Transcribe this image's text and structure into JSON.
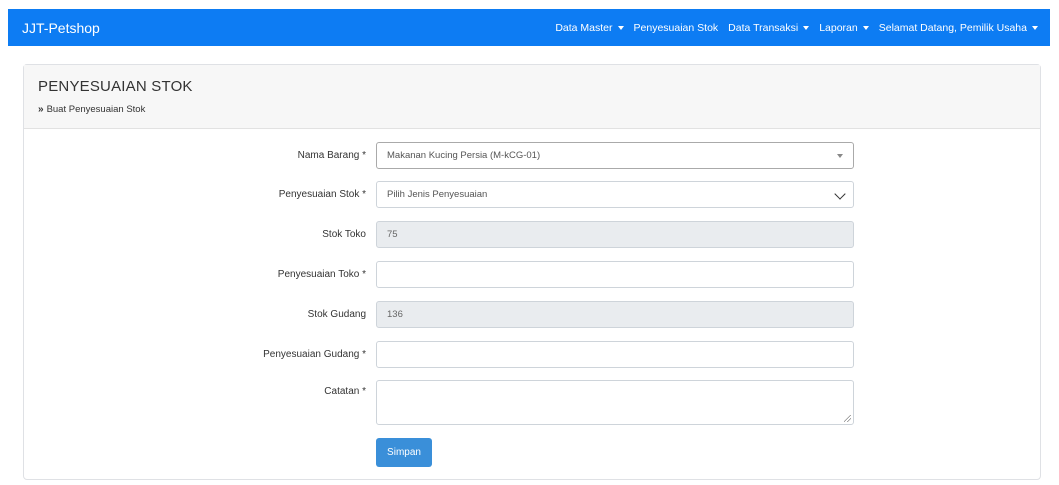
{
  "navbar": {
    "brand": "JJT-Petshop",
    "items": [
      {
        "label": "Data Master",
        "dropdown": true
      },
      {
        "label": "Penyesuaian Stok",
        "dropdown": false
      },
      {
        "label": "Data Transaksi",
        "dropdown": true
      },
      {
        "label": "Laporan",
        "dropdown": true
      },
      {
        "label": "Selamat Datang, Pemilik Usaha",
        "dropdown": true
      }
    ]
  },
  "page": {
    "title": "PENYESUAIAN STOK",
    "breadcrumb": "Buat Penyesuaian Stok",
    "breadcrumb_icon": "»"
  },
  "form": {
    "nama_barang": {
      "label": "Nama Barang *",
      "value": "Makanan Kucing Persia (M-kCG-01)"
    },
    "penyesuaian_stok": {
      "label": "Penyesuaian Stok *",
      "value": "Pilih Jenis Penyesuaian"
    },
    "stok_toko": {
      "label": "Stok Toko",
      "value": "75"
    },
    "penyesuaian_toko": {
      "label": "Penyesuaian Toko *",
      "value": ""
    },
    "stok_gudang": {
      "label": "Stok Gudang",
      "value": "136"
    },
    "penyesuaian_gudang": {
      "label": "Penyesuaian Gudang *",
      "value": ""
    },
    "catatan": {
      "label": "Catatan *",
      "value": ""
    },
    "submit_label": "Simpan"
  },
  "colors": {
    "navbar": "#0d7cf3",
    "button": "#3a8fd9",
    "readonly_bg": "#e9ecef"
  }
}
